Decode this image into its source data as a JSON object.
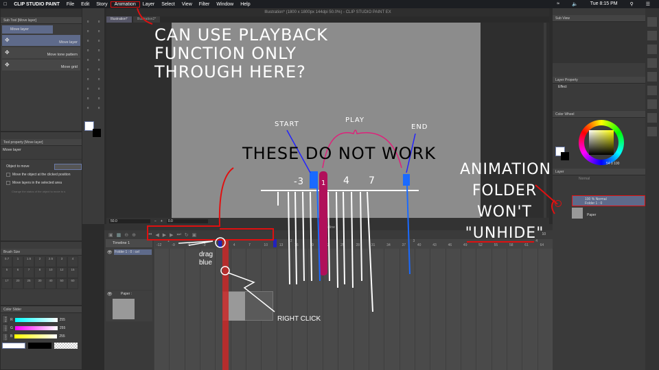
{
  "menubar": {
    "app": "CLIP STUDIO PAINT",
    "items": [
      "File",
      "Edit",
      "Story",
      "Animation",
      "Layer",
      "Select",
      "View",
      "Filter",
      "Window",
      "Help"
    ],
    "clock": "Tue 8:15 PM"
  },
  "window": {
    "title": "Illustration* (1800 x 1800px 144dpi 50.0%)  - CLIP STUDIO PAINT EX",
    "tabs": [
      "Illustration*",
      "Illustration2*"
    ]
  },
  "subtool": {
    "tab": "Sub Tool [Move layer]",
    "group": "Move layer",
    "items": [
      "Move layer",
      "Move tone pattern",
      "Move grid"
    ]
  },
  "toolprop": {
    "tab": "Tool property [Move layer]",
    "title": "Move layer",
    "object_label": "Object to move",
    "options": [
      "Move the object at the clicked position",
      "Move layers in the selected area",
      "Change the status of the object to move to s"
    ]
  },
  "brushsize": {
    "tab": "Brush Size",
    "sizes": [
      "0.7",
      "1",
      "1.5",
      "2",
      "2.5",
      "3",
      "4",
      "5",
      "6",
      "7",
      "8",
      "10",
      "12",
      "15",
      "17",
      "20",
      "25",
      "30",
      "40",
      "50",
      "60"
    ]
  },
  "colorslider": {
    "tab": "Color Slider",
    "modes": [
      "RGB",
      "HSV",
      "CMY"
    ],
    "channels": [
      {
        "label": "R",
        "value": "255"
      },
      {
        "label": "G",
        "value": "255"
      },
      {
        "label": "B",
        "value": "255"
      }
    ]
  },
  "statusbar": {
    "zoom": "50.0",
    "angle": "0.0"
  },
  "timeline": {
    "tab": "Timeline",
    "name": "Timeline 1",
    "tracks": [
      "Folder 1 : 0 : cel",
      "Paper :"
    ],
    "seconds": [
      "1",
      "2",
      "3",
      "4",
      "5"
    ],
    "frames": [
      "-12",
      "-9",
      "-6",
      "-3",
      "1",
      "4",
      "7",
      "10",
      "13",
      "16",
      "19",
      "22",
      "25",
      "28",
      "31",
      "34",
      "37",
      "40",
      "43",
      "46",
      "49",
      "52",
      "55",
      "58",
      "61",
      "64"
    ],
    "end_value": "10"
  },
  "right": {
    "subview_tab": "Sub View",
    "layerprop_tab": "Layer Property",
    "effect_label": "Effect",
    "colorwheel_tab": "Color Wheel",
    "wheel_values": "54  0  100",
    "layer_tab": "Layer",
    "blend": "Normal",
    "layers": [
      {
        "mode": "100 % Normal",
        "name": "Folder 1 : 0"
      },
      {
        "mode": "",
        "name": "Paper"
      }
    ]
  },
  "annotations": {
    "q1": [
      "CAN USE PLAYBACK",
      "FUNCTION ONLY",
      "THROUGH HERE?"
    ],
    "these": "THESE DO NOT WORK",
    "start": "START",
    "play": "PLAY",
    "end": "END",
    "ruler": [
      "-3",
      "1",
      "4",
      "7"
    ],
    "drag": [
      "drag",
      "blue"
    ],
    "right_click": "RIGHT CLICK",
    "folder": [
      "ANIMATION",
      "FOLDER",
      "WON'T",
      "\"UNHIDE\""
    ]
  },
  "colors": {
    "accent": "#5e6a8a",
    "annot_red": "#e01010",
    "play_pink": "#e0207a",
    "marker_blue": "#1a6aff"
  }
}
